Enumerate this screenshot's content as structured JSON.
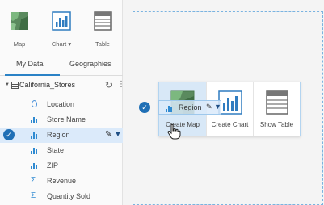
{
  "toolbar": {
    "map_label": "Map",
    "chart_label": "Chart ▾",
    "table_label": "Table"
  },
  "tabs": {
    "my_data": "My Data",
    "geographies": "Geographies"
  },
  "dataset": {
    "name": "California_Stores",
    "refresh_icon": "↻",
    "more_icon": "⋮"
  },
  "fields": [
    {
      "label": "Location",
      "icon": "location-icon"
    },
    {
      "label": "Store Name",
      "icon": "string-field-icon"
    },
    {
      "label": "Region",
      "icon": "string-field-icon",
      "selected": true
    },
    {
      "label": "State",
      "icon": "string-field-icon"
    },
    {
      "label": "ZIP",
      "icon": "string-field-icon"
    },
    {
      "label": "Revenue",
      "icon": "number-field-icon"
    },
    {
      "label": "Quantity Sold",
      "icon": "number-field-icon"
    }
  ],
  "drop_menu": {
    "create_map": "Create Map",
    "create_chart": "Create Chart",
    "show_table": "Show Table"
  },
  "drag_preview": {
    "label": "Region"
  },
  "colors": {
    "accent": "#1f6fb5",
    "selection": "#dbeafa",
    "dropzone_border": "#7ab3e0"
  }
}
